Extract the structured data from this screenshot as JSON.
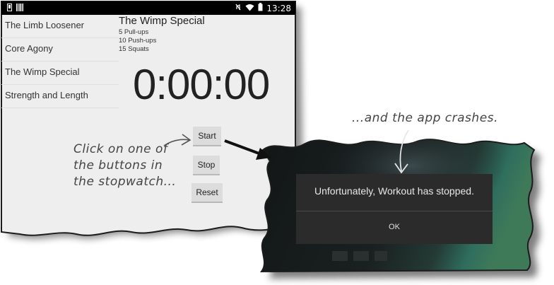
{
  "status_bar": {
    "time": "13:28",
    "left_icons": [
      "phone-icon",
      "barcode-icon"
    ],
    "right_icons": [
      "mute-icon",
      "wifi-icon",
      "battery-icon"
    ]
  },
  "workouts": [
    "The Limb Loosener",
    "Core Agony",
    "The Wimp Special",
    "Strength and Length"
  ],
  "detail": {
    "title": "The Wimp Special",
    "lines": [
      "5 Pull-ups",
      "10 Push-ups",
      "15 Squats"
    ]
  },
  "stopwatch": {
    "time": "0:00:00",
    "start_label": "Start",
    "stop_label": "Stop",
    "reset_label": "Reset"
  },
  "annotations": {
    "left_lines": [
      "Click on one of",
      "the buttons in",
      "the stopwatch..."
    ],
    "right": "...and the app crashes."
  },
  "dialog": {
    "message": "Unfortunately, Workout has stopped.",
    "ok_label": "OK"
  },
  "colors": {
    "screen_bg": "#eeeeee",
    "status_bar": "#000000",
    "dialog_bg": "#2b2b2b",
    "dim_bg": "#141a1a",
    "teal_accent": "#2f6e5e"
  }
}
